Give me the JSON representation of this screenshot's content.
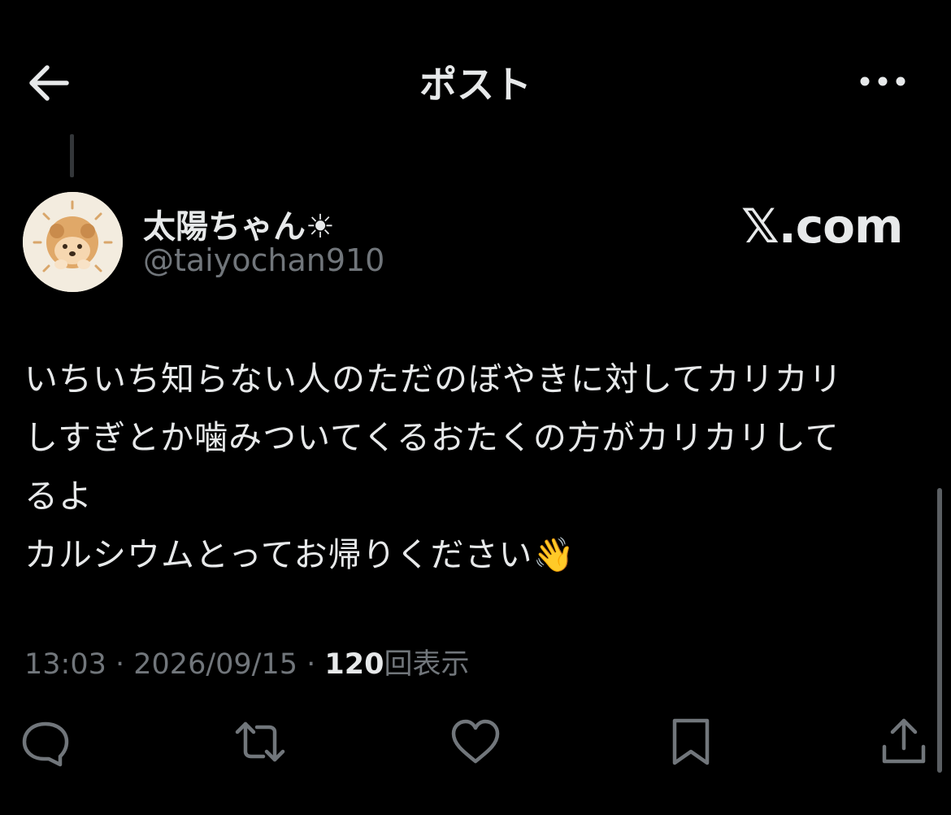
{
  "header": {
    "title": "ポスト",
    "back_icon": "arrow-left-icon",
    "more_icon": "more-horizontal-icon"
  },
  "post": {
    "author": {
      "display_name": "太陽ちゃん☀︎",
      "handle": "@taiyochan910"
    },
    "watermark": "𝕏.com",
    "text": "いちいち知らない人のただのぼやきに対してカリカリ\nしすぎとか噛みついてくるおたくの方がカリカリして\nるよ\nカルシウムとってお帰りください👋",
    "time": "13:03",
    "separator": " · ",
    "date": "2026/09/15",
    "views_count": "120",
    "views_label": "回表示"
  },
  "actions": [
    {
      "name": "reply",
      "icon": "reply-icon"
    },
    {
      "name": "repost",
      "icon": "repost-icon"
    },
    {
      "name": "like",
      "icon": "heart-icon"
    },
    {
      "name": "bookmark",
      "icon": "bookmark-icon"
    },
    {
      "name": "share",
      "icon": "share-icon"
    }
  ],
  "colors": {
    "background": "#000000",
    "text_primary": "#e7e9ea",
    "text_secondary": "#71767b"
  }
}
